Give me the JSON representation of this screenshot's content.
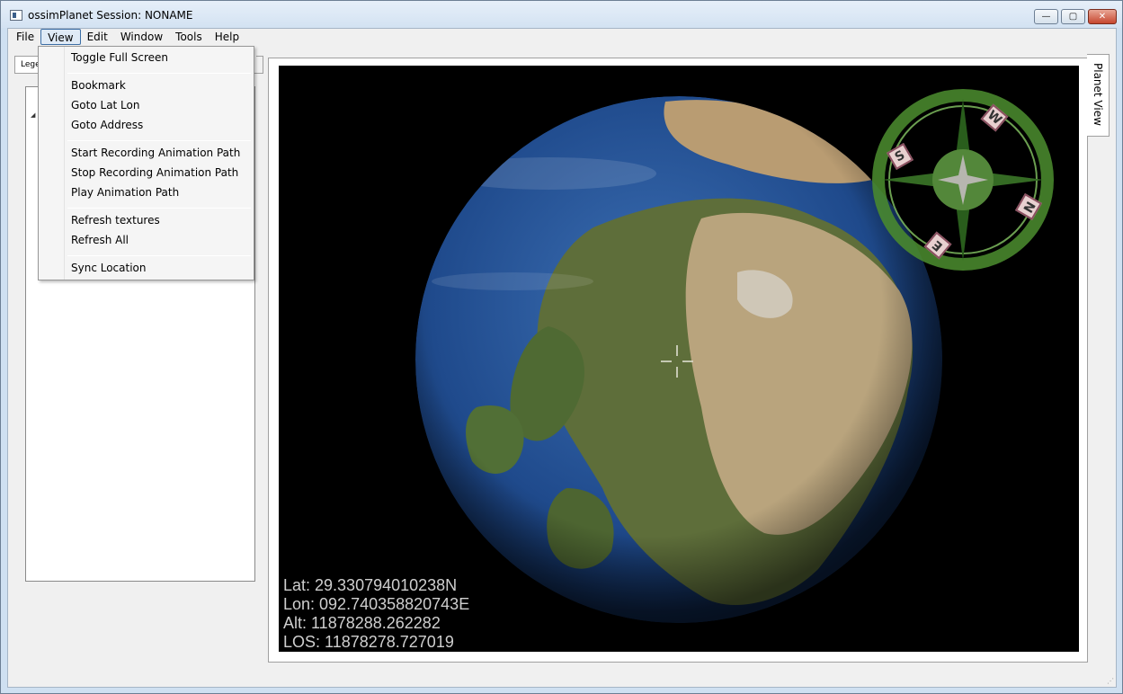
{
  "window": {
    "title": "ossimPlanet Session: NONAME",
    "buttons": {
      "minimize": "—",
      "maximize": "▢",
      "close": "✕"
    }
  },
  "menubar": {
    "items": [
      "File",
      "View",
      "Edit",
      "Window",
      "Tools",
      "Help"
    ],
    "active": "View"
  },
  "view_menu": {
    "items": [
      "Toggle Full Screen",
      "Bookmark",
      "Goto Lat Lon",
      "Goto Address",
      "Start Recording Animation Path",
      "Stop Recording Animation Path",
      "Play Animation Path",
      "Refresh textures",
      "Refresh All",
      "Sync Location"
    ]
  },
  "left_panel": {
    "tab_label": "Legend"
  },
  "planet": {
    "tab_label": "Planet View",
    "readout": {
      "lat": "Lat: 29.330794010238N",
      "lon": "Lon: 092.740358820743E",
      "alt": "Alt: 11878288.262282",
      "los": "LOS: 11878278.727019"
    },
    "compass": {
      "n": "N",
      "e": "E",
      "s": "S",
      "w": "W"
    }
  },
  "colors": {
    "ocean": "#1f4a8c",
    "land": "#5e6e3a",
    "desert": "#b9a47d",
    "compass": "#4a8a2e"
  }
}
